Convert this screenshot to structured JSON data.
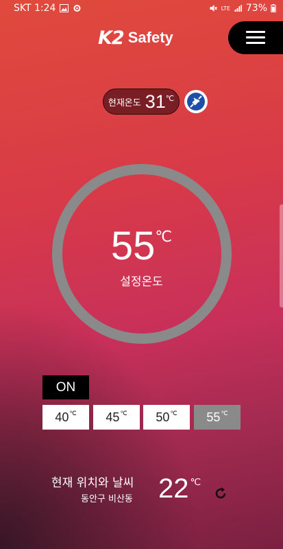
{
  "status_bar": {
    "carrier_time": "SKT 1:24",
    "network": "LTE",
    "battery": "73%"
  },
  "brand": {
    "logo_k2": "K2",
    "logo_safety": "Safety"
  },
  "current_temp": {
    "label": "현재온도",
    "value": "31",
    "unit": "℃"
  },
  "dial": {
    "set_value": "55",
    "unit": "℃",
    "label": "설정온도"
  },
  "power": {
    "label": "ON"
  },
  "presets": [
    {
      "value": "40",
      "unit": "℃",
      "selected": false
    },
    {
      "value": "45",
      "unit": "℃",
      "selected": false
    },
    {
      "value": "50",
      "unit": "℃",
      "selected": false
    },
    {
      "value": "55",
      "unit": "℃",
      "selected": true
    }
  ],
  "weather": {
    "title": "현재 위치와 날씨",
    "location": "동안구 비산동",
    "temp": "22",
    "unit": "℃"
  },
  "icons": [
    "image-icon",
    "gear-icon",
    "mute-icon",
    "signal-icon",
    "battery-icon",
    "menu-icon",
    "plug-icon",
    "refresh-icon"
  ],
  "colors": {
    "dial_ring": "#8a8a8a",
    "accent_bg": "#d83a48",
    "button_dark": "#000000"
  }
}
